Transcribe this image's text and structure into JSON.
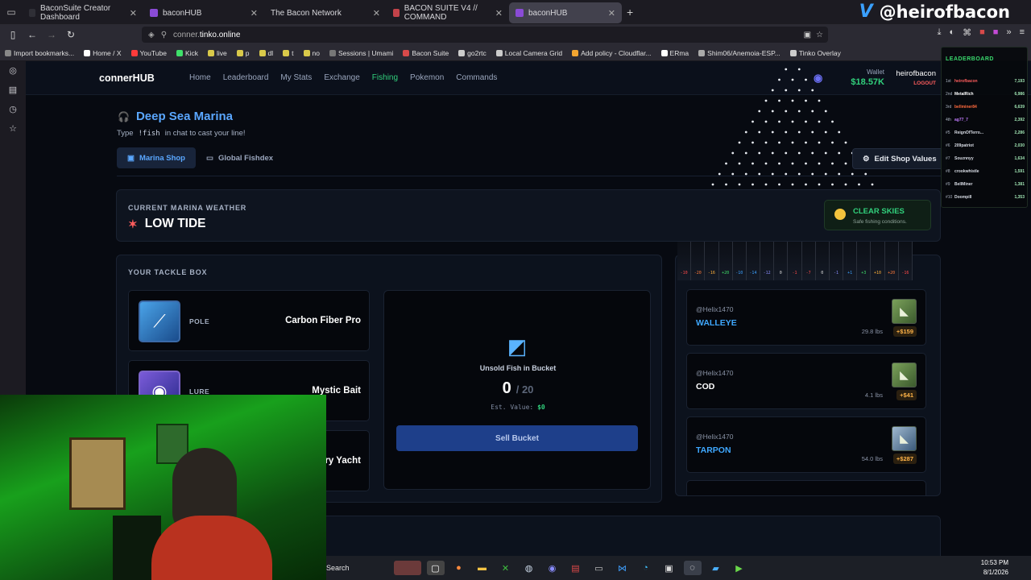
{
  "browser": {
    "tabs": [
      {
        "title": "BaconSuite Creator Dashboard",
        "active": false
      },
      {
        "title": "baconHUB",
        "active": false
      },
      {
        "title": "The Bacon Network",
        "active": false
      },
      {
        "title": "BACON SUITE V4 // COMMAND",
        "active": false
      },
      {
        "title": "baconHUB",
        "active": true
      }
    ],
    "url_host": "tinko.online",
    "url_prefix": "conner.",
    "bookmarks": [
      "Import bookmarks...",
      "Home / X",
      "YouTube",
      "Kick",
      "live",
      "p",
      "dl",
      "t",
      "no",
      "Sessions | Umami",
      "Bacon Suite",
      "go2rtc",
      "Local Camera Grid",
      "Add policy - Cloudflar...",
      "ERma",
      "Shim06/Anemoia-ESP...",
      "Tinko Overlay"
    ]
  },
  "overlay": {
    "twitch_handle": "@heirofbacon",
    "leaderboard_title": "LEADERBOARD",
    "leaderboard": [
      {
        "rank": "1st",
        "name": "heirofbacon",
        "points": "7,193",
        "color": "#ff5d5d"
      },
      {
        "rank": "2nd",
        "name": "MetalRich",
        "points": "6,986",
        "color": "#ffffff"
      },
      {
        "rank": "3rd",
        "name": "bellminer84",
        "points": "6,639",
        "color": "#ff6a3d"
      },
      {
        "rank": "4th",
        "name": "ag77_7",
        "points": "2,392",
        "color": "#c27cff"
      },
      {
        "rank": "#5",
        "name": "ReignOfTerro...",
        "points": "2,286",
        "color": "#d9dde6"
      },
      {
        "rank": "#6",
        "name": "209patriot",
        "points": "2,030",
        "color": "#d9dde6"
      },
      {
        "rank": "#7",
        "name": "Souznnyy",
        "points": "1,634",
        "color": "#d9dde6"
      },
      {
        "rank": "#8",
        "name": "crookwhistle",
        "points": "1,591",
        "color": "#d9dde6"
      },
      {
        "rank": "#9",
        "name": "BellMiner",
        "points": "1,381",
        "color": "#d9dde6"
      },
      {
        "rank": "#10",
        "name": "Doompill",
        "points": "1,353",
        "color": "#d9dde6"
      }
    ]
  },
  "site": {
    "brand": "connerHUB",
    "nav": [
      "Home",
      "Leaderboard",
      "My Stats",
      "Exchange",
      "Fishing",
      "Pokemon",
      "Commands"
    ],
    "active_nav": "Fishing",
    "wallet_label": "Wallet",
    "wallet_value": "$18.57K",
    "username": "heirofbacon",
    "logout": "LOGOUT"
  },
  "marina": {
    "title": "Deep Sea Marina",
    "subtitle_pre": "Type",
    "subtitle_cmd": "!fish",
    "subtitle_post": "in chat to cast your line!",
    "tabs": [
      "Marina Shop",
      "Global Fishdex"
    ],
    "edit_button": "Edit Shop Values",
    "weather_label": "CURRENT MARINA WEATHER",
    "weather_value": "LOW TIDE",
    "skies_title": "CLEAR SKIES",
    "skies_desc": "Safe fishing conditions."
  },
  "tackle": {
    "title": "YOUR TACKLE BOX",
    "items": [
      {
        "slot": "POLE",
        "name": "Carbon Fiber Pro"
      },
      {
        "slot": "LURE",
        "name": "Mystic Bait"
      },
      {
        "slot": "",
        "name": "ry Yacht"
      }
    ],
    "bucket_label": "Unsold Fish in Bucket",
    "bucket_count": "0",
    "bucket_max": "/ 20",
    "est_label": "Est. Value:",
    "est_value": "$0",
    "sell_button": "Sell Bucket"
  },
  "meter_labels": [
    "-10",
    "-20",
    "-16",
    "+20",
    "-10",
    "-14",
    "-12",
    "0",
    "-1",
    "-7",
    "0",
    "-1",
    "+1",
    "+3",
    "+10",
    "+20",
    "-16"
  ],
  "catches": [
    {
      "user": "@Helix1470",
      "fish": "WALLEYE",
      "weight": "29.8 lbs",
      "price": "+$159",
      "color": "#3fa8ff"
    },
    {
      "user": "@Helix1470",
      "fish": "COD",
      "weight": "4.1 lbs",
      "price": "+$41",
      "color": "#ffffff"
    },
    {
      "user": "@Helix1470",
      "fish": "TARPON",
      "weight": "54.0 lbs",
      "price": "+$287",
      "color": "#3fa8ff"
    }
  ],
  "taskbar": {
    "search": "Search",
    "time": "10:53 PM",
    "date": "8/1/2026"
  }
}
